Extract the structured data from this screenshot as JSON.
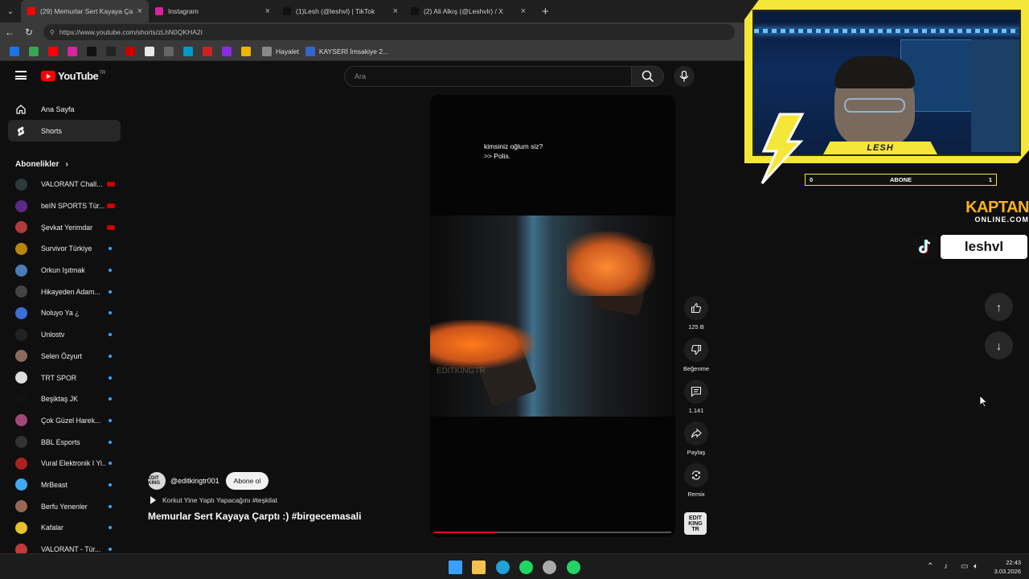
{
  "browser": {
    "tabs": [
      {
        "label": "(29) Memurlar Sert Kayaya Ça",
        "favicon_color": "#ff0000",
        "active": true
      },
      {
        "label": "Instagram",
        "favicon_color": "#d6249f",
        "active": false
      },
      {
        "label": "(1)Lesh (@leshvl) | TikTok",
        "favicon_color": "#111111",
        "active": false
      },
      {
        "label": "(2) Ali Alkış (@Leshvlr) / X",
        "favicon_color": "#111111",
        "active": false
      }
    ],
    "url": "https://www.youtube.com/shorts/zLhN0QKHA2I",
    "bookmarks": [
      {
        "color": "#1a73e8"
      },
      {
        "color": "#34a853"
      },
      {
        "color": "#ff0000"
      },
      {
        "color": "#d6249f"
      },
      {
        "color": "#111111"
      },
      {
        "color": "#222222"
      },
      {
        "color": "#cc0000"
      },
      {
        "color": "#e8e8e8"
      },
      {
        "color": "#666666"
      },
      {
        "color": "#0099cc"
      },
      {
        "color": "#cc2222"
      },
      {
        "color": "#8a2be2"
      },
      {
        "color": "#f0b400"
      }
    ],
    "bookmark_links": [
      {
        "label": "Hayalet",
        "color": "#888888"
      },
      {
        "label": "KAYSERİ İmsakiye 2...",
        "color": "#3366cc"
      }
    ]
  },
  "youtube": {
    "logo_text": "YouTube",
    "country_code": "TR",
    "search_placeholder": "Ara",
    "nav": [
      {
        "label": "Ana Sayfa",
        "icon": "home-icon",
        "active": false
      },
      {
        "label": "Shorts",
        "icon": "shorts-icon",
        "active": true
      }
    ],
    "subscriptions_title": "Abonelikler",
    "subscriptions": [
      {
        "name": "VALORANT Chall...",
        "color": "#2b3a3a",
        "indicator": "live"
      },
      {
        "name": "beIN SPORTS Tür...",
        "color": "#5b2a86",
        "indicator": "live"
      },
      {
        "name": "Şevkat Yerimdar",
        "color": "#b23a3a",
        "indicator": "live"
      },
      {
        "name": "Survivor Türkiye",
        "color": "#b8860b",
        "indicator": "dot"
      },
      {
        "name": "Orkun Işıtmak",
        "color": "#4a7db5",
        "indicator": "dot"
      },
      {
        "name": "Hikayeden Adam...",
        "color": "#444444",
        "indicator": "dot"
      },
      {
        "name": "Noluyo Ya ¿",
        "color": "#3b6fd4",
        "indicator": "dot"
      },
      {
        "name": "Unlostv",
        "color": "#222222",
        "indicator": "dot"
      },
      {
        "name": "Selen Özyurt",
        "color": "#8a6a5a",
        "indicator": "dot"
      },
      {
        "name": "TRT SPOR",
        "color": "#dddddd",
        "indicator": "dot"
      },
      {
        "name": "Beşiktaş JK",
        "color": "#111111",
        "indicator": "dot"
      },
      {
        "name": "Çok Güzel Harek...",
        "color": "#a04878",
        "indicator": "dot"
      },
      {
        "name": "BBL Esports",
        "color": "#333333",
        "indicator": "dot"
      },
      {
        "name": "Vural Elektronik I Yi...",
        "color": "#aa2222",
        "indicator": "dot"
      },
      {
        "name": "MrBeast",
        "color": "#3fa9f5",
        "indicator": "dot"
      },
      {
        "name": "Berfu Yenenler",
        "color": "#996655",
        "indicator": "dot"
      },
      {
        "name": "Kafalar",
        "color": "#e8c12a",
        "indicator": "dot"
      },
      {
        "name": "VALORANT - Tür...",
        "color": "#c23a3a",
        "indicator": "dot"
      }
    ],
    "short": {
      "caption_lines": [
        "kimsiniz oğlum siz?",
        ">> Polis."
      ],
      "watermark": "EDITKINGTR",
      "progress": 0.26,
      "channel_handle": "@editkingtr001",
      "channel_avatar_text": "EDIT KING",
      "subscribe_label": "Abone ol",
      "music": "Korkut Yine Yaptı Yapacağını #teşkilat",
      "title": "Memurlar Sert Kayaya Çarptı :) #birgecemasali",
      "actions": [
        {
          "icon": "like-icon",
          "label": "125 B"
        },
        {
          "icon": "dislike-icon",
          "label": "Beğenme"
        },
        {
          "icon": "comment-icon",
          "label": "1.141"
        },
        {
          "icon": "share-icon",
          "label": "Paylaş"
        },
        {
          "icon": "remix-icon",
          "label": "Remix"
        }
      ],
      "channel_thumb_text": "EDIT KING TR"
    }
  },
  "overlay": {
    "streamer_name": "LESH",
    "sub_goal_label": "ABONE",
    "sub_goal_current": "0",
    "sub_goal_target": "1",
    "sponsor_main": "KAPTAN",
    "sponsor_sub": "ONLINE.COM",
    "tiktok_handle": "leshvl",
    "frame_color": "#f5e63a"
  },
  "taskbar": {
    "apps": [
      {
        "icon": "windows-start-icon",
        "color": "#3aa0ff"
      },
      {
        "icon": "file-explorer-icon",
        "color": "#f2c14e"
      },
      {
        "icon": "edge-icon",
        "color": "#1fa3d6"
      },
      {
        "icon": "spotify-icon",
        "color": "#1ed760"
      },
      {
        "icon": "settings-app-icon",
        "color": "#aaaaaa"
      },
      {
        "icon": "whatsapp-icon",
        "color": "#25d366"
      }
    ],
    "time": "22:43",
    "date": "3.03.2026"
  }
}
